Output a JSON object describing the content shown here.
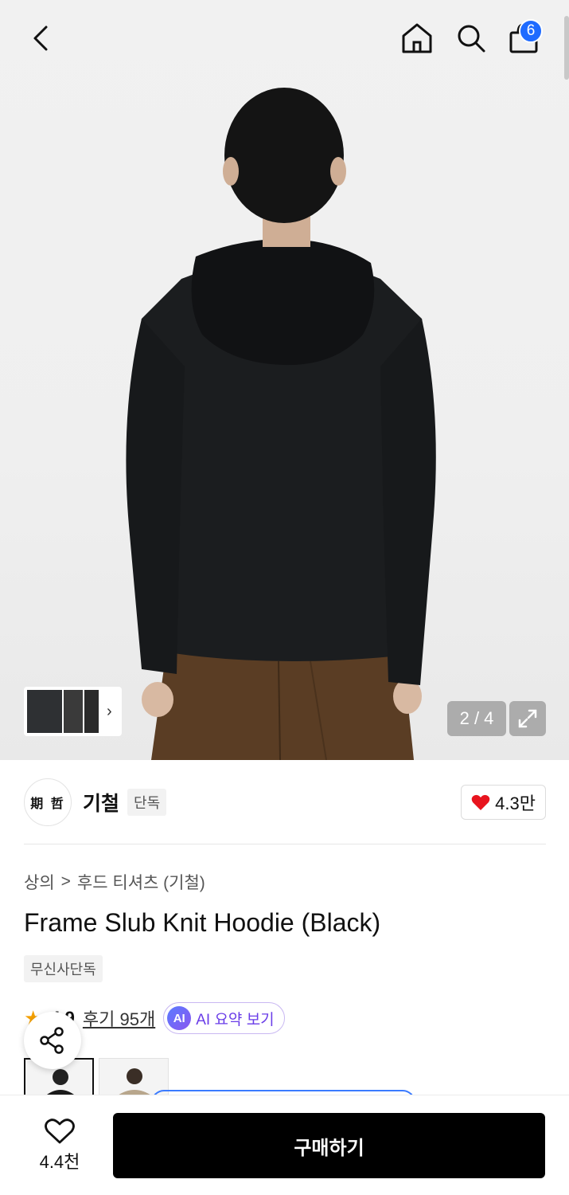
{
  "header": {
    "back_icon": "chevron-left-icon",
    "home_icon": "home-icon",
    "search_icon": "search-icon",
    "cart_icon": "shopping-bag-icon",
    "cart_count": "6"
  },
  "gallery": {
    "pager": "2 / 4",
    "expand_icon": "expand-icon",
    "thumbnail_more_icon": "chevron-right-icon"
  },
  "brand": {
    "name": "기철",
    "tag": "단독",
    "like_count": "4.3만",
    "logo_text": "期 哲"
  },
  "breadcrumb": {
    "category": "상의",
    "separator": ">",
    "subcategory": "후드 티셔츠 (기철)"
  },
  "product": {
    "title": "Frame Slub Knit Hoodie (Black)",
    "exclusive_badge": "무신사단독",
    "rating": "4.9",
    "review_link": "후기 95개",
    "ai_badge": "AI",
    "ai_summary_label": "AI 요약 보기"
  },
  "bottom_bar": {
    "wish_count": "4.4천",
    "buy_label": "구매하기"
  },
  "colors": {
    "accent_blue": "#1f6bff",
    "heart_red": "#e8141e",
    "ai_purple": "#6a3de8",
    "buy_button": "#000000"
  }
}
